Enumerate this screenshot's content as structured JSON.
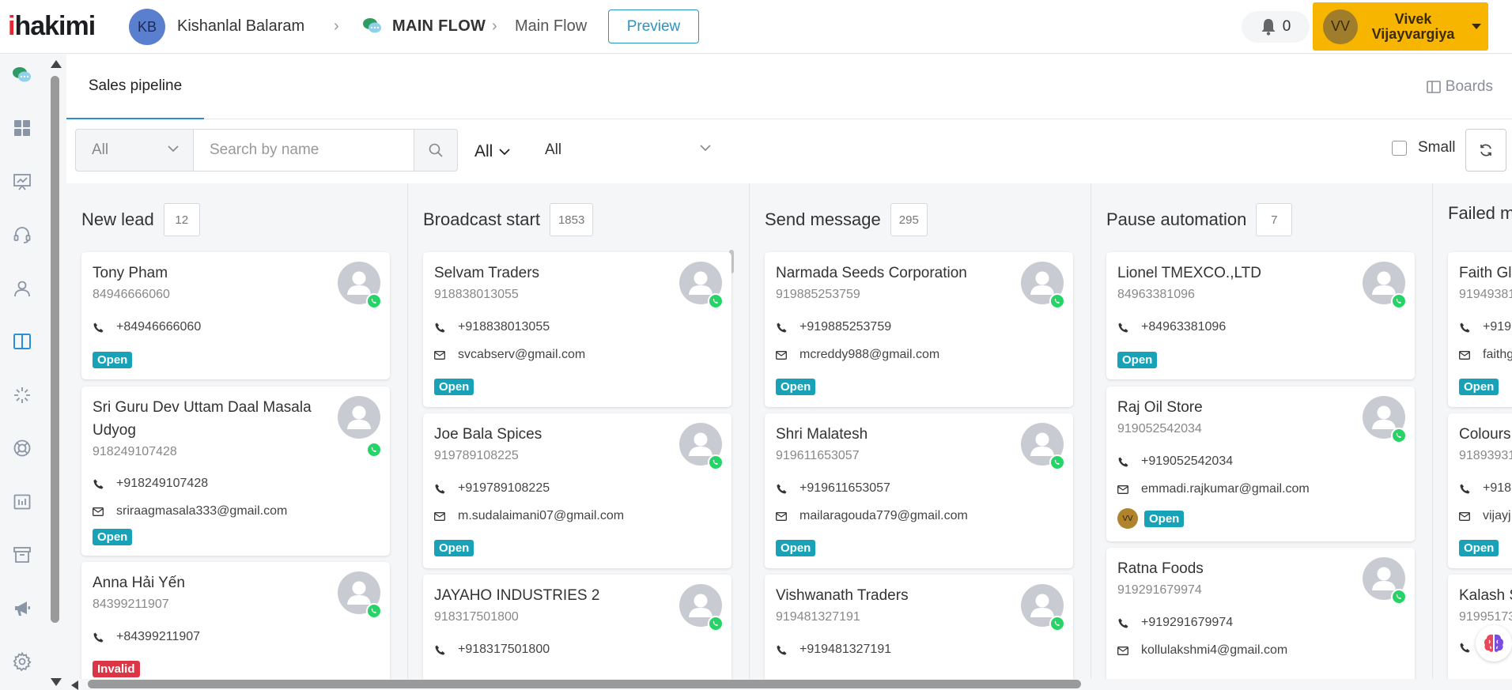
{
  "header": {
    "logo_i": "i",
    "logo_rest": "hakimi",
    "account_initials": "KB",
    "account_name": "Kishanlal Balaram",
    "flow_name": "MAIN FLOW",
    "flow_sub": "Main Flow",
    "preview_label": "Preview",
    "notification_count": "0",
    "user_initials": "VV",
    "user_name": "Vivek Vijayvargiya"
  },
  "tabs": {
    "active": "Sales pipeline",
    "boards_label": "Boards"
  },
  "filters": {
    "type_select": "All",
    "search_placeholder": "Search by name",
    "status_select": "All",
    "agent_select": "All",
    "small_label": "Small"
  },
  "columns": [
    {
      "title": "New lead",
      "count": "12",
      "cards": [
        {
          "name": "Tony Pham",
          "sub": "84946666060",
          "phone": "+84946666060",
          "email": "",
          "badge": "Open"
        },
        {
          "name": "Sri Guru Dev Uttam Daal Masala Udyog",
          "sub": "918249107428",
          "phone": "+918249107428",
          "email": "sriraagmasala333@gmail.com",
          "badge": "Open"
        },
        {
          "name": "Anna Hải Yến",
          "sub": "84399211907",
          "phone": "+84399211907",
          "email": "",
          "badge": "Invalid"
        }
      ]
    },
    {
      "title": "Broadcast start",
      "count": "1853",
      "cards": [
        {
          "name": "Selvam Traders",
          "sub": "918838013055",
          "phone": "+918838013055",
          "email": "svcabserv@gmail.com",
          "badge": "Open"
        },
        {
          "name": "Joe Bala Spices",
          "sub": "919789108225",
          "phone": "+919789108225",
          "email": "m.sudalaimani07@gmail.com",
          "badge": "Open"
        },
        {
          "name": "JAYAHO INDUSTRIES 2",
          "sub": "918317501800",
          "phone": "+918317501800",
          "email": "",
          "badge": ""
        }
      ]
    },
    {
      "title": "Send message",
      "count": "295",
      "cards": [
        {
          "name": "Narmada Seeds Corporation",
          "sub": "919885253759",
          "phone": "+919885253759",
          "email": "mcreddy988@gmail.com",
          "badge": "Open"
        },
        {
          "name": "Shri Malatesh",
          "sub": "919611653057",
          "phone": "+919611653057",
          "email": "mailaragouda779@gmail.com",
          "badge": "Open"
        },
        {
          "name": "Vishwanath Traders",
          "sub": "919481327191",
          "phone": "+919481327191",
          "email": "",
          "badge": ""
        }
      ]
    },
    {
      "title": "Pause automation",
      "count": "7",
      "cards": [
        {
          "name": "Lionel TMEXCO.,LTD",
          "sub": "84963381096",
          "phone": "+84963381096",
          "email": "",
          "badge": "Open"
        },
        {
          "name": "Raj Oil Store",
          "sub": "919052542034",
          "phone": "+919052542034",
          "email": "emmadi.rajkumar@gmail.com",
          "badge": "Open",
          "assignee": "VV"
        },
        {
          "name": "Ratna Foods",
          "sub": "919291679974",
          "phone": "+919291679974",
          "email": "kollulakshmi4@gmail.com",
          "badge": ""
        }
      ]
    },
    {
      "title": "Failed m",
      "cards": [
        {
          "name": "Faith Gl",
          "sub": "91949381",
          "phone": "+919",
          "email": "faithg",
          "badge": "Open"
        },
        {
          "name": "Colours",
          "sub": "91893931",
          "phone": "+918",
          "email": "vijayj",
          "badge": "Open"
        },
        {
          "name": "Kalash S",
          "sub": "91995173",
          "phone": "",
          "email": "",
          "badge": ""
        }
      ]
    }
  ],
  "colors": {
    "accent": "#2a8fd6",
    "open_badge": "#17a2b8",
    "invalid_badge": "#dc3545",
    "user_button": "#f7b500",
    "whatsapp": "#25d366"
  }
}
